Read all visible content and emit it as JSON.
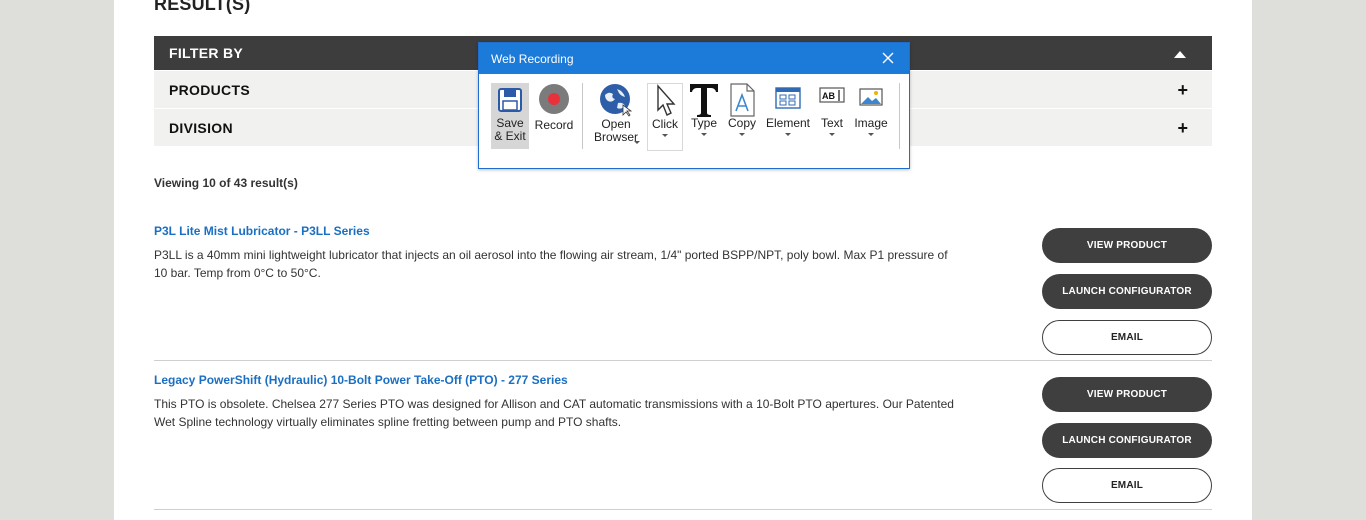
{
  "page": {
    "results_heading": "RESULT(S)",
    "filter_label": "FILTER BY",
    "filters": [
      "PRODUCTS",
      "DIVISION"
    ],
    "viewing_text": "Viewing 10 of 43 result(s)"
  },
  "products": [
    {
      "title": "P3L Lite Mist Lubricator - P3LL Series",
      "description": "P3LL is a 40mm mini lightweight lubricator that injects an oil aerosol into the flowing air stream, 1/4\" ported BSPP/NPT, poly bowl. Max P1 pressure of 10 bar. Temp from 0°C to 50°C.",
      "view_label": "VIEW PRODUCT",
      "configure_label": "LAUNCH CONFIGURATOR",
      "email_label": "EMAIL"
    },
    {
      "title": "Legacy PowerShift (Hydraulic) 10-Bolt Power Take-Off (PTO) - 277 Series",
      "description": "This PTO is obsolete. Chelsea 277 Series PTO was designed for Allison and CAT automatic transmissions with a 10-Bolt PTO apertures. Our Patented Wet Spline technology virtually eliminates spline fretting between pump and PTO shafts.",
      "view_label": "VIEW PRODUCT",
      "configure_label": "LAUNCH CONFIGURATOR",
      "email_label": "EMAIL"
    }
  ],
  "recorder": {
    "title": "Web Recording",
    "tools": {
      "save_exit": "Save\n& Exit",
      "record": "Record",
      "open_browser": "Open\nBrowser",
      "click": "Click",
      "type": "Type",
      "copy": "Copy",
      "element": "Element",
      "text": "Text",
      "image": "Image"
    },
    "colors": {
      "titlebar": "#1c7ad8",
      "record_dot": "#e8313b"
    }
  }
}
